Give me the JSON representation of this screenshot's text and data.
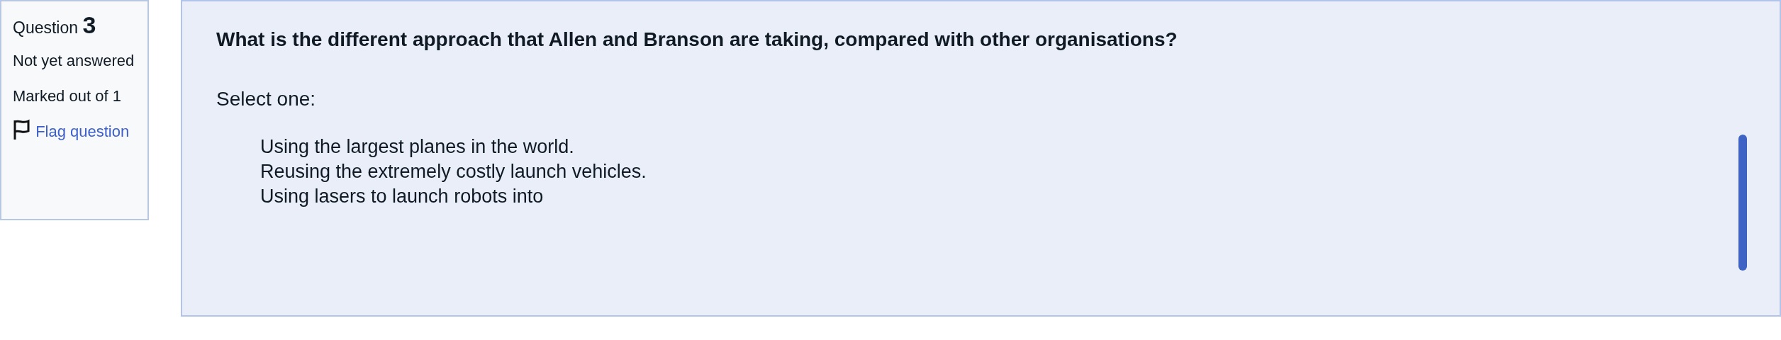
{
  "info": {
    "label": "Question",
    "number": "3",
    "status": "Not yet answered",
    "marks": "Marked out of 1",
    "flag_link": "Flag question"
  },
  "question": {
    "text": "What is the different approach that Allen and Branson are taking, compared with other organisations?",
    "prompt": "Select one:",
    "options": [
      {
        "text": "Using the largest planes in the world."
      },
      {
        "text": "Reusing the extremely costly launch vehicles."
      },
      {
        "text": "Using lasers to launch robots into"
      }
    ]
  }
}
